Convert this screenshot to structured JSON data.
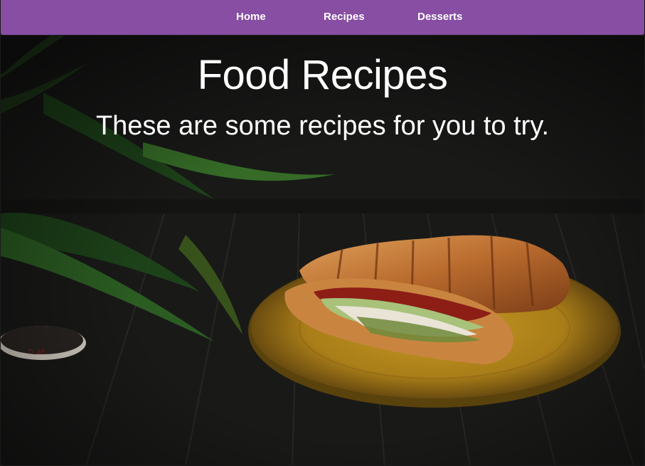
{
  "nav": {
    "items": [
      {
        "label": "Home"
      },
      {
        "label": "Recipes"
      },
      {
        "label": "Desserts"
      }
    ],
    "background_color": "#874ea3"
  },
  "hero": {
    "title": "Food Recipes",
    "subtitle": "These are some recipes for you to try.",
    "image_alt_semantic": "croissant-sandwich-plate-photo"
  }
}
